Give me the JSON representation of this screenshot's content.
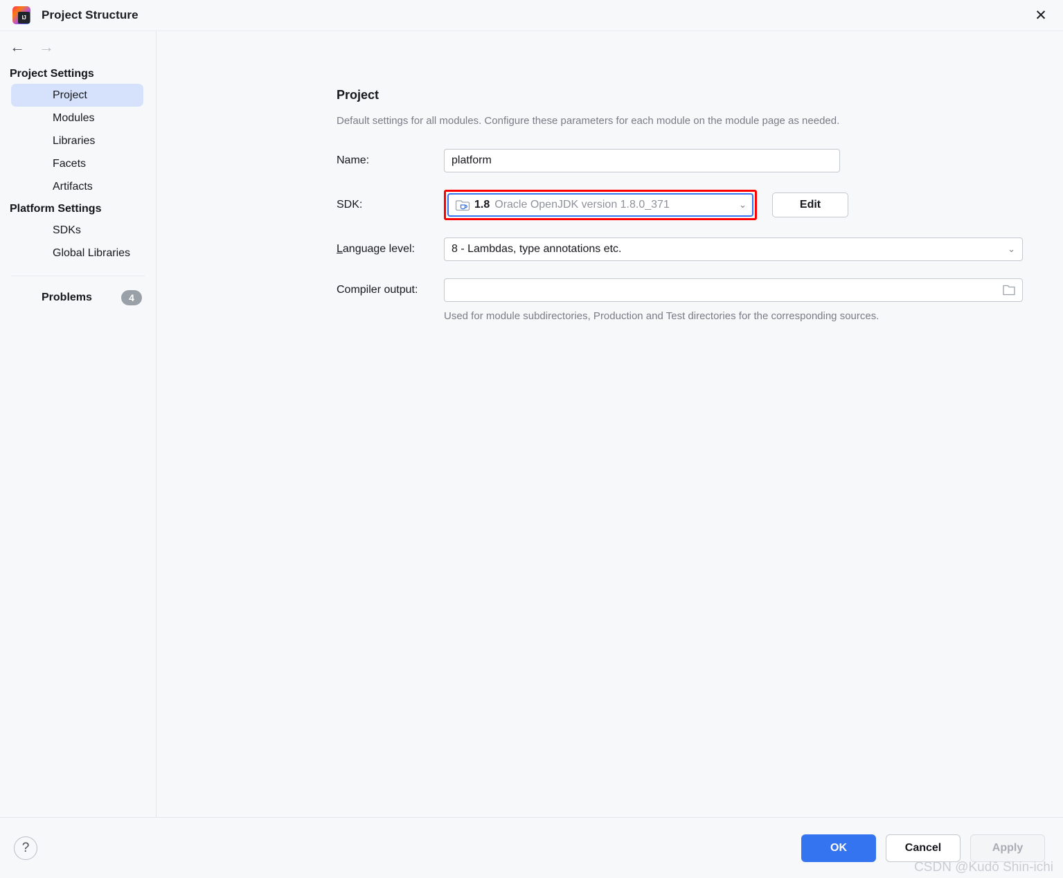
{
  "window": {
    "title": "Project Structure",
    "logo_text": "IJ",
    "close_icon": "✕"
  },
  "nav": {
    "back_icon": "←",
    "forward_icon": "→"
  },
  "sidebar": {
    "groups": [
      {
        "title": "Project Settings",
        "items": [
          {
            "label": "Project",
            "selected": true
          },
          {
            "label": "Modules",
            "selected": false
          },
          {
            "label": "Libraries",
            "selected": false
          },
          {
            "label": "Facets",
            "selected": false
          },
          {
            "label": "Artifacts",
            "selected": false
          }
        ]
      },
      {
        "title": "Platform Settings",
        "items": [
          {
            "label": "SDKs",
            "selected": false
          },
          {
            "label": "Global Libraries",
            "selected": false
          }
        ]
      }
    ],
    "problems": {
      "label": "Problems",
      "count": "4"
    }
  },
  "main": {
    "title": "Project",
    "description": "Default settings for all modules. Configure these parameters for each module on the module page as needed.",
    "name_field": {
      "label": "Name:",
      "value": "platform",
      "placeholder": ""
    },
    "sdk_field": {
      "label": "SDK:",
      "version": "1.8",
      "name": "Oracle OpenJDK version 1.8.0_371",
      "caret": "⌄",
      "edit_label": "Edit",
      "highlight_color": "#ff0000",
      "focus_color": "#3574f0"
    },
    "language_level_field": {
      "label_mnemonic": "L",
      "label_rest": "anguage level:",
      "value": "8 - Lambdas, type annotations etc.",
      "caret": "⌄"
    },
    "compiler_output_field": {
      "label": "Compiler output:",
      "value": "",
      "placeholder": "",
      "hint": "Used for module subdirectories, Production and Test directories for the corresponding sources."
    }
  },
  "footer": {
    "help_icon": "?",
    "ok_label": "OK",
    "cancel_label": "Cancel",
    "apply_label": "Apply",
    "watermark": "CSDN @Kudō Shin-ichi"
  }
}
